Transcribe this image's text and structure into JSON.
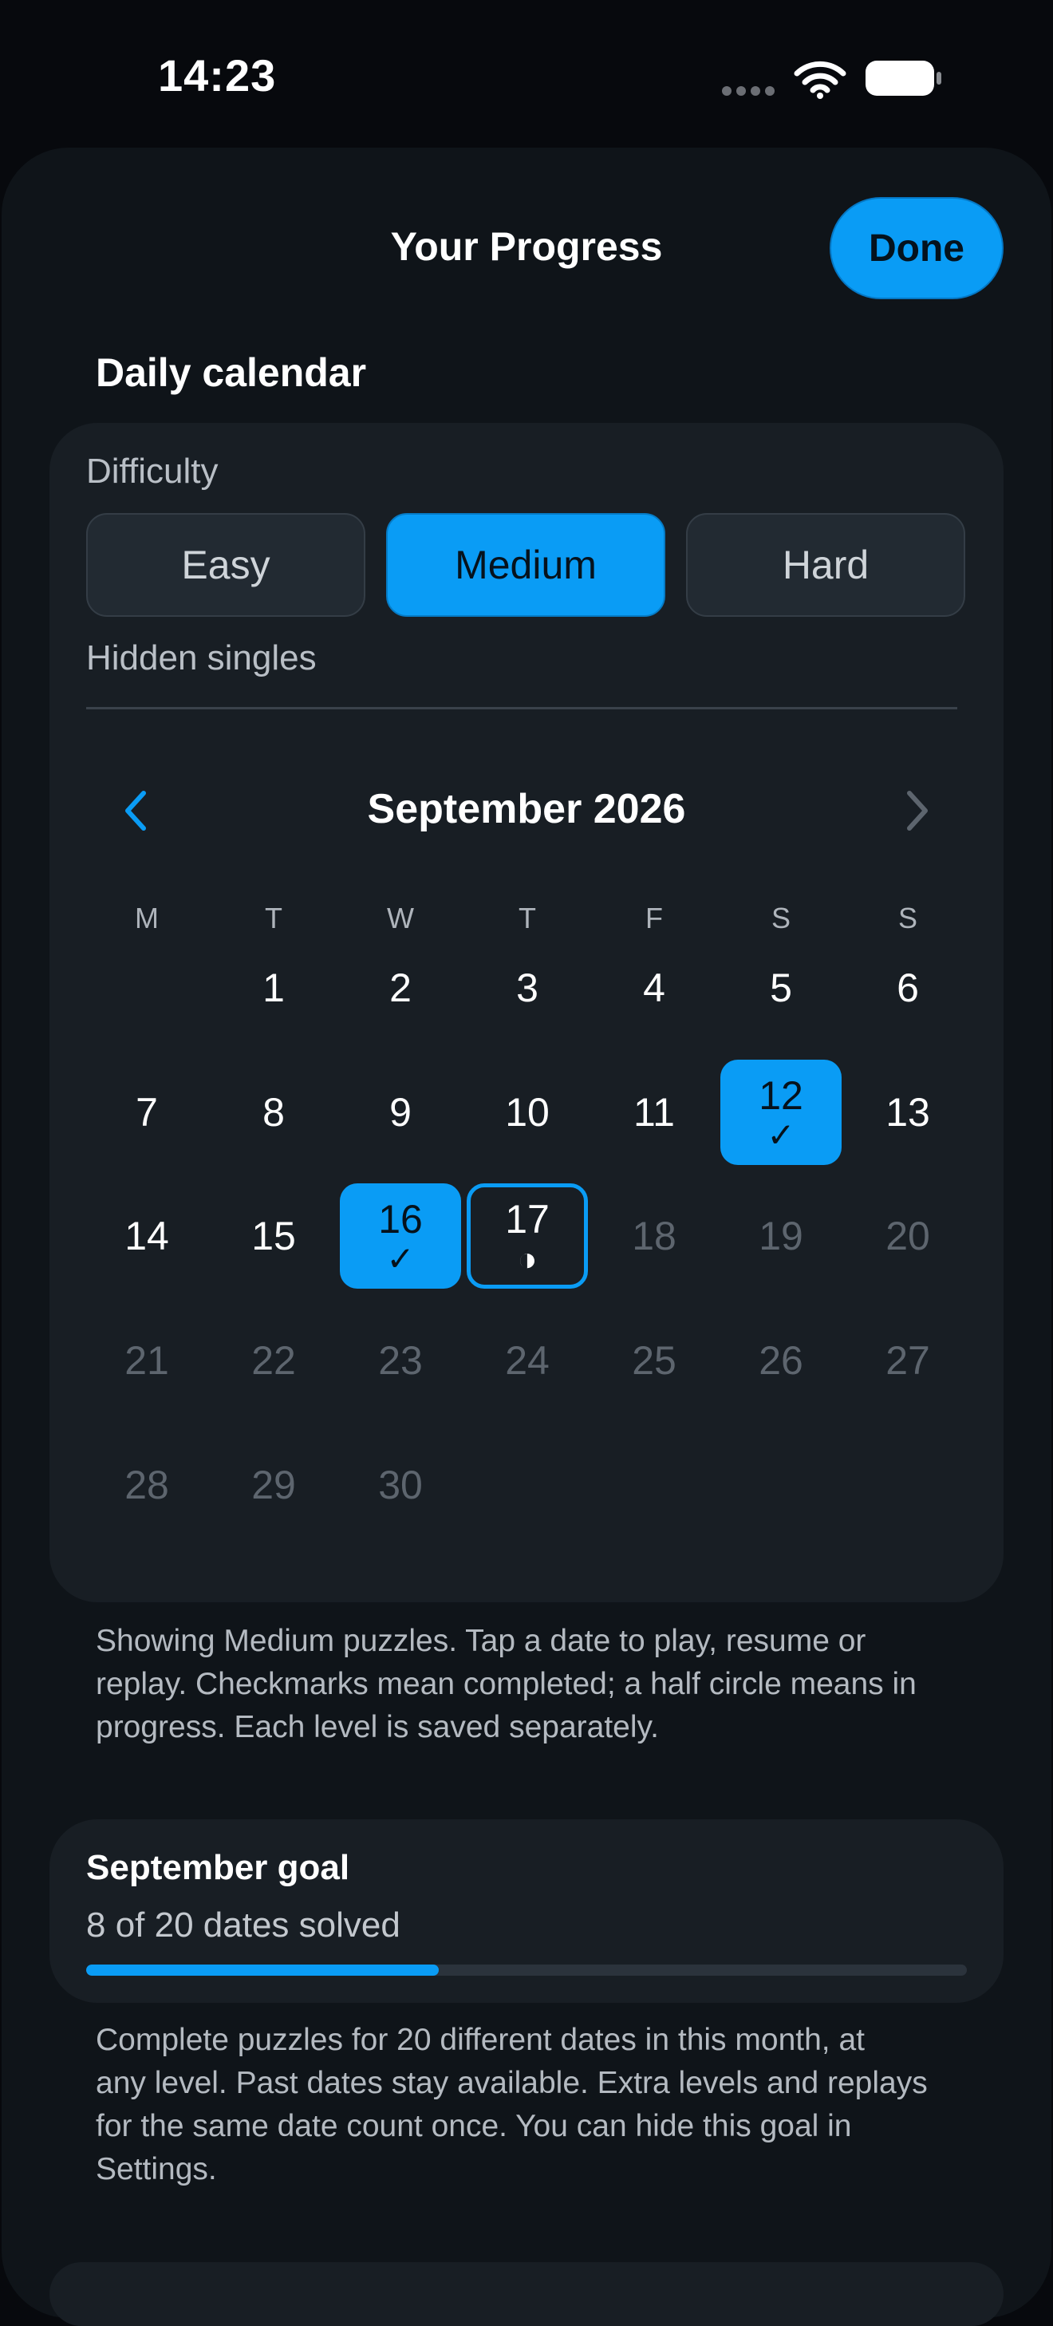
{
  "status_bar": {
    "time": "14:23"
  },
  "header": {
    "title": "Your Progress",
    "done_label": "Done"
  },
  "section": {
    "heading": "Daily calendar"
  },
  "difficulty": {
    "label": "Difficulty",
    "options": [
      "Easy",
      "Medium",
      "Hard"
    ],
    "selected": "Medium",
    "technique": "Hidden singles"
  },
  "calendar": {
    "month_label": "September 2026",
    "weekdays": [
      "M",
      "T",
      "W",
      "T",
      "F",
      "S",
      "S"
    ],
    "weeks": [
      [
        null,
        1,
        2,
        3,
        4,
        5,
        6
      ],
      [
        7,
        8,
        9,
        10,
        11,
        12,
        13
      ],
      [
        14,
        15,
        16,
        17,
        18,
        19,
        20
      ],
      [
        21,
        22,
        23,
        24,
        25,
        26,
        27
      ],
      [
        28,
        29,
        30,
        null,
        null,
        null,
        null
      ]
    ],
    "completed_days": [
      12,
      16
    ],
    "in_progress_days": [
      17
    ],
    "today": 17,
    "completed_mark": "✓",
    "in_progress_mark": "◑",
    "colors": {
      "accent": "#0a9cf5",
      "future": "#5d656e"
    }
  },
  "notes": {
    "calendar": [
      "Showing Medium puzzles. Tap a date to play, resume or",
      "replay. Checkmarks mean completed; a half circle means in",
      "progress. Each level is saved separately."
    ],
    "goal": [
      "Complete puzzles for 20 different dates in this month, at",
      "any level. Past dates stay available. Extra levels and replays",
      "for the same date count once. You can hide this goal in",
      "Settings."
    ]
  },
  "goal": {
    "title": "September goal",
    "progress_text": "8 of 20 dates solved",
    "solved": 8,
    "target": 20
  }
}
